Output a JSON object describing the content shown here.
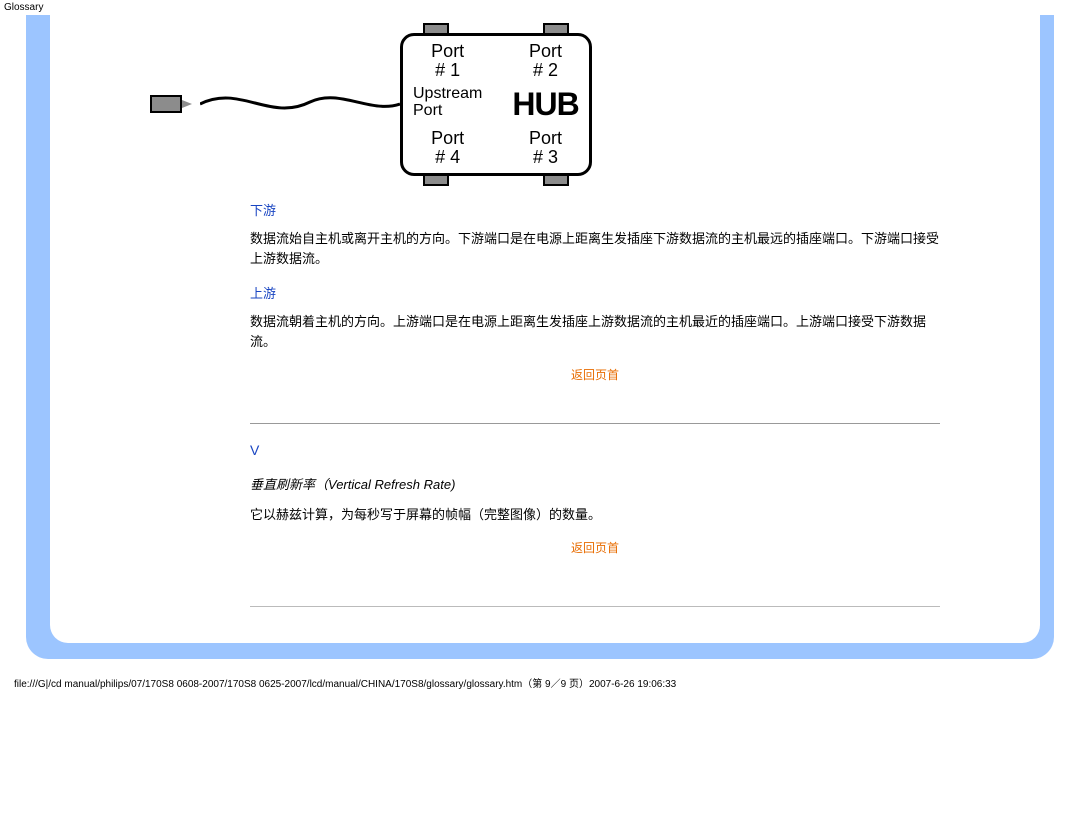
{
  "header": {
    "title": "Glossary"
  },
  "hub": {
    "port1_line1": "Port",
    "port1_line2": "# 1",
    "port2_line1": "Port",
    "port2_line2": "# 2",
    "upstream_line1": "Upstream",
    "upstream_line2": "Port",
    "hub_label": "HUB",
    "port4_line1": "Port",
    "port4_line2": "# 4",
    "port3_line1": "Port",
    "port3_line2": "# 3"
  },
  "sections": {
    "downstream": {
      "heading": "下游",
      "body": "数据流始自主机或离开主机的方向。下游端口是在电源上距离生发插座下游数据流的主机最远的插座端口。下游端口接受上游数据流。"
    },
    "upstream": {
      "heading": "上游",
      "body": "数据流朝着主机的方向。上游端口是在电源上距离生发插座上游数据流的主机最近的插座端口。上游端口接受下游数据流。"
    },
    "return_top1": "返回页首",
    "letter_v": "V",
    "vrr": {
      "heading": "垂直刷新率（Vertical Refresh Rate)",
      "body": "它以赫兹计算，为每秒写于屏幕的帧幅（完整图像）的数量。"
    },
    "return_top2": "返回页首"
  },
  "footer": {
    "path": "file:///G|/cd manual/philips/07/170S8 0608-2007/170S8 0625-2007/lcd/manual/CHINA/170S8/glossary/glossary.htm（第 9／9 页）2007-6-26 19:06:33"
  }
}
